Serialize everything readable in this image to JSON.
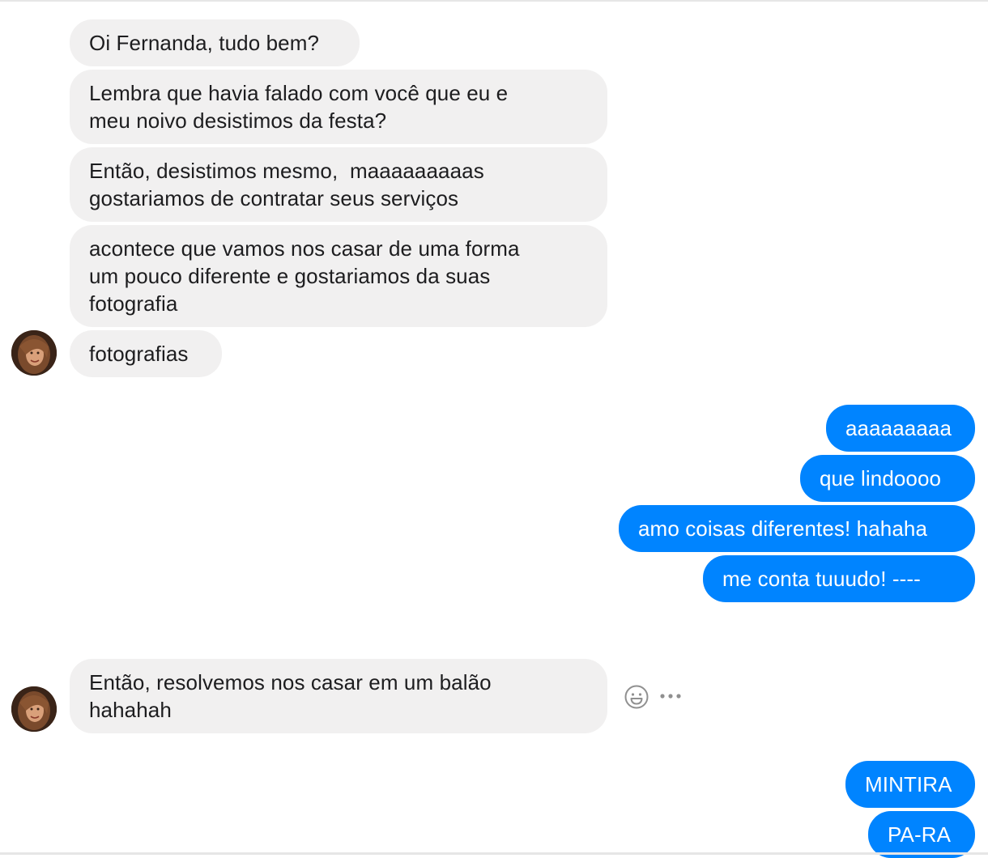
{
  "incoming": [
    {
      "text": "Oi Fernanda, tudo bem?"
    },
    {
      "text": "Lembra que havia falado com você que eu e\nmeu noivo desistimos da festa?"
    },
    {
      "text": "Então, desistimos mesmo,  maaaaaaaaas\ngostariamos de contratar seus serviços"
    },
    {
      "text": "acontece que vamos nos casar de uma forma\num pouco diferente e gostariamos da suas\nfotografia"
    },
    {
      "text": "fotografias"
    },
    {
      "text": "Então, resolvemos nos casar em um balão\nhahahah"
    }
  ],
  "outgoing": [
    {
      "text": "aaaaaaaaa"
    },
    {
      "text": "que lindoooo"
    },
    {
      "text": "amo coisas diferentes! hahaha"
    },
    {
      "text": "me conta tuuudo! ----"
    },
    {
      "text": "MINTIRA"
    },
    {
      "text": "PA-RA"
    }
  ],
  "message_actions": {
    "react_icon": "smiley-face-icon",
    "more_icon": "more-options-icon"
  },
  "colors": {
    "incoming_bubble": "#f1f0f0",
    "outgoing_bubble": "#0084ff"
  }
}
